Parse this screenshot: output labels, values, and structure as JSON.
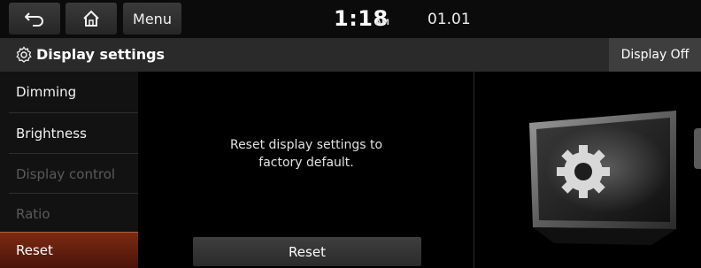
{
  "topbar": {
    "back_icon": "back-arrow-icon",
    "home_icon": "home-icon",
    "menu_label": "Menu",
    "time": "1:18",
    "ampm": "AM",
    "date": "01.01"
  },
  "titlebar": {
    "icon": "gear-icon",
    "title": "Display settings",
    "display_off_label": "Display Off"
  },
  "sidebar": {
    "items": [
      {
        "label": "Dimming",
        "state": "enabled"
      },
      {
        "label": "Brightness",
        "state": "enabled"
      },
      {
        "label": "Display control",
        "state": "disabled"
      },
      {
        "label": "Ratio",
        "state": "disabled"
      },
      {
        "label": "Reset",
        "state": "selected"
      }
    ]
  },
  "main": {
    "message_line1": "Reset display settings to",
    "message_line2": "factory default.",
    "reset_button_label": "Reset"
  },
  "preview": {
    "image": "display-gear-illustration-icon"
  },
  "colors": {
    "selected_accent": "#7c2a12",
    "disabled_text": "#5a5a5a"
  }
}
